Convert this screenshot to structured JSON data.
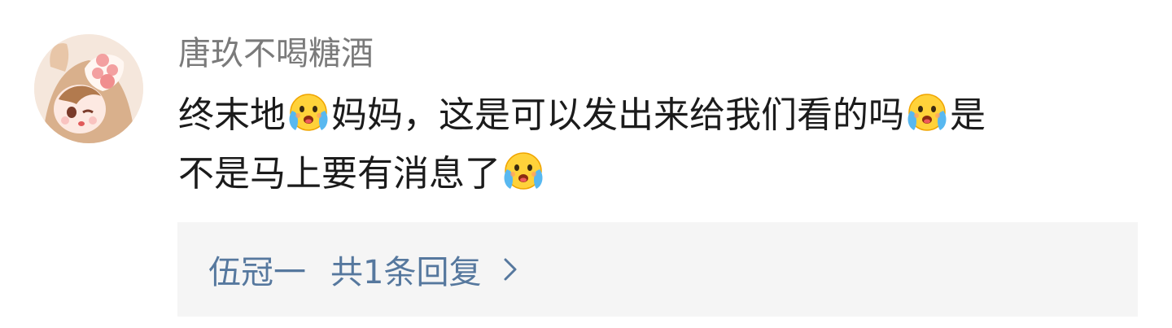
{
  "comment": {
    "username": "唐玖不喝糖酒",
    "line1_a": "终末地",
    "line1_b": "妈妈，这是可以发出来给我们看的吗",
    "line1_c": "是",
    "line2_a": "不是马上要有消息了",
    "emoji_name": "crying-laughing-emoji-icon"
  },
  "replies": {
    "reply_user": "伍冠一",
    "reply_summary": "共1条回复"
  },
  "colors": {
    "username": "#7a7a7a",
    "text": "#1b1b1b",
    "link": "#56789e",
    "reply_bg": "#f5f5f5"
  }
}
